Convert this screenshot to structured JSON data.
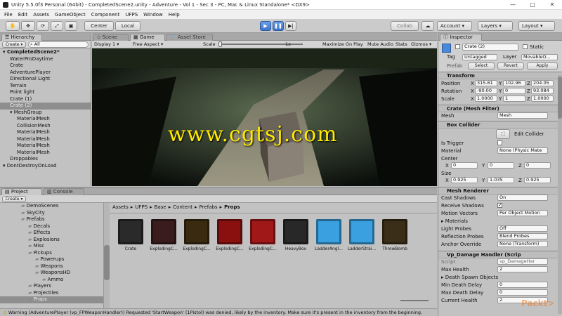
{
  "window": {
    "title": "Unity 5.5.0f3 Personal (64bit) - CompletedScene2.unity - Adventure - Vol 1 - Sec 3 - PC, Mac & Linux Standalone* <DX9>"
  },
  "menu": [
    "File",
    "Edit",
    "Assets",
    "GameObject",
    "Component",
    "UFPS",
    "Window",
    "Help"
  ],
  "toolbar": {
    "center": "Center",
    "local": "Local",
    "collab": "Collab",
    "account": "Account",
    "layers": "Layers",
    "layout": "Layout"
  },
  "hierarchy": {
    "tab": "Hierarchy",
    "create": "Create",
    "search": "All",
    "items": [
      {
        "label": "CompletedScene2*",
        "indent": 0,
        "bold": true
      },
      {
        "label": "WaterProDaytime",
        "indent": 1
      },
      {
        "label": "Crate",
        "indent": 1
      },
      {
        "label": "AdventurePlayer",
        "indent": 1
      },
      {
        "label": "Directional Light",
        "indent": 1
      },
      {
        "label": "Terrain",
        "indent": 1
      },
      {
        "label": "Point light",
        "indent": 1
      },
      {
        "label": "Crate (1)",
        "indent": 1
      },
      {
        "label": "Crate (2)",
        "indent": 1,
        "selected": true
      },
      {
        "label": "MeshGroup",
        "indent": 1
      },
      {
        "label": "MaterialMesh",
        "indent": 2
      },
      {
        "label": "CollisionMesh",
        "indent": 2
      },
      {
        "label": "MaterialMesh",
        "indent": 2
      },
      {
        "label": "MaterialMesh",
        "indent": 2
      },
      {
        "label": "MaterialMesh",
        "indent": 2
      },
      {
        "label": "MaterialMesh",
        "indent": 2
      },
      {
        "label": "Droppables",
        "indent": 1
      },
      {
        "label": "DontDestroyOnLoad",
        "indent": 0
      }
    ]
  },
  "scene": {
    "tab_scene": "Scene",
    "tab_game": "Game",
    "tab_store": "Asset Store",
    "display": "Display 1",
    "aspect": "Free Aspect",
    "scale_label": "Scale",
    "scale_value": "1x",
    "maximize": "Maximize On Play",
    "mute": "Mute Audio",
    "stats": "Stats",
    "gizmos": "Gizmos",
    "watermark": "www.cgtsj.com"
  },
  "project": {
    "tab_project": "Project",
    "tab_console": "Console",
    "create": "Create",
    "tree": [
      "DemoScenes",
      "SkyCity",
      "Prefabs",
      "Decals",
      "Effects",
      "Explosions",
      "Misc",
      "Pickups",
      "Powerups",
      "Weapons",
      "WeaponsHD",
      "Ammo",
      "Players",
      "Projectiles",
      "Props"
    ],
    "breadcrumb": [
      "Assets",
      "UFPS",
      "Base",
      "Content",
      "Prefabs",
      "Props"
    ],
    "assets": [
      {
        "name": "Crate",
        "color": "#2a2a2a"
      },
      {
        "name": "ExplodingC...",
        "color": "#3a1c1c"
      },
      {
        "name": "ExplodingC...",
        "color": "#3a2a10"
      },
      {
        "name": "ExplodingC...",
        "color": "#8a1010"
      },
      {
        "name": "ExplodingC...",
        "color": "#a01818"
      },
      {
        "name": "HeavyBox",
        "color": "#282828"
      },
      {
        "name": "LadderAngl...",
        "color": "#3aa0e0"
      },
      {
        "name": "LadderStrai...",
        "color": "#3aa0e0"
      },
      {
        "name": "ThrowBomb",
        "color": "#3a2e18"
      }
    ]
  },
  "status": {
    "warning": "Warning (AdventurePlayer (vp_FPWeaponHandler)) Requested 'StartWeapon' (1Pistol) was denied, likely by the inventory. Make sure it's present in the inventory from the beginning."
  },
  "inspector": {
    "tab": "Inspector",
    "name": "Crate (2)",
    "static": "Static",
    "tag_label": "Tag",
    "tag": "Untagged",
    "layer_label": "Layer",
    "layer": "MovableO...",
    "prefab": "Prefab",
    "select": "Select",
    "revert": "Revert",
    "apply": "Apply",
    "transform": {
      "title": "Transform",
      "position": [
        "315.61",
        "102.96",
        "204.05"
      ],
      "rotation": [
        "-90.00",
        "0",
        "93.084"
      ],
      "scale": [
        "1.0000",
        "1",
        "1.0000"
      ]
    },
    "mesh_filter": {
      "title": "Crate (Mesh Filter)",
      "mesh_label": "Mesh",
      "mesh": "Mesh"
    },
    "box_collider": {
      "title": "Box Collider",
      "edit": "Edit Collider",
      "trigger": "Is Trigger",
      "material_label": "Material",
      "material": "None (Physic Mate",
      "center_label": "Center",
      "center": [
        "0",
        "0",
        "0"
      ],
      "size_label": "Size",
      "size": [
        "0.925",
        "1.035",
        "0.925"
      ]
    },
    "mesh_renderer": {
      "title": "Mesh Renderer",
      "cast_shadows": "Cast Shadows",
      "cast_value": "On",
      "receive_shadows": "Receive Shadows",
      "motion_vectors": "Motion Vectors",
      "motion_value": "Per Object Motion",
      "materials": "Materials",
      "light_probes": "Light Probes",
      "light_value": "Off",
      "reflection_probes": "Reflection Probes",
      "reflection_value": "Blend Probes",
      "anchor": "Anchor Override",
      "anchor_value": "None (Transform)"
    },
    "damage": {
      "title": "Vp_Damage Handler (Scrip",
      "script_label": "Script",
      "script": "vp_DamageHar",
      "max_health": "Max Health",
      "max_health_value": "2",
      "death_spawn": "Death Spawn Objects",
      "min_delay": "Min Death Delay",
      "min_delay_value": "0",
      "max_delay": "Max Death Delay",
      "max_delay_value": "0",
      "current_health": "Current Health",
      "current_health_value": "2"
    }
  },
  "watermark_corner": "Packt>"
}
